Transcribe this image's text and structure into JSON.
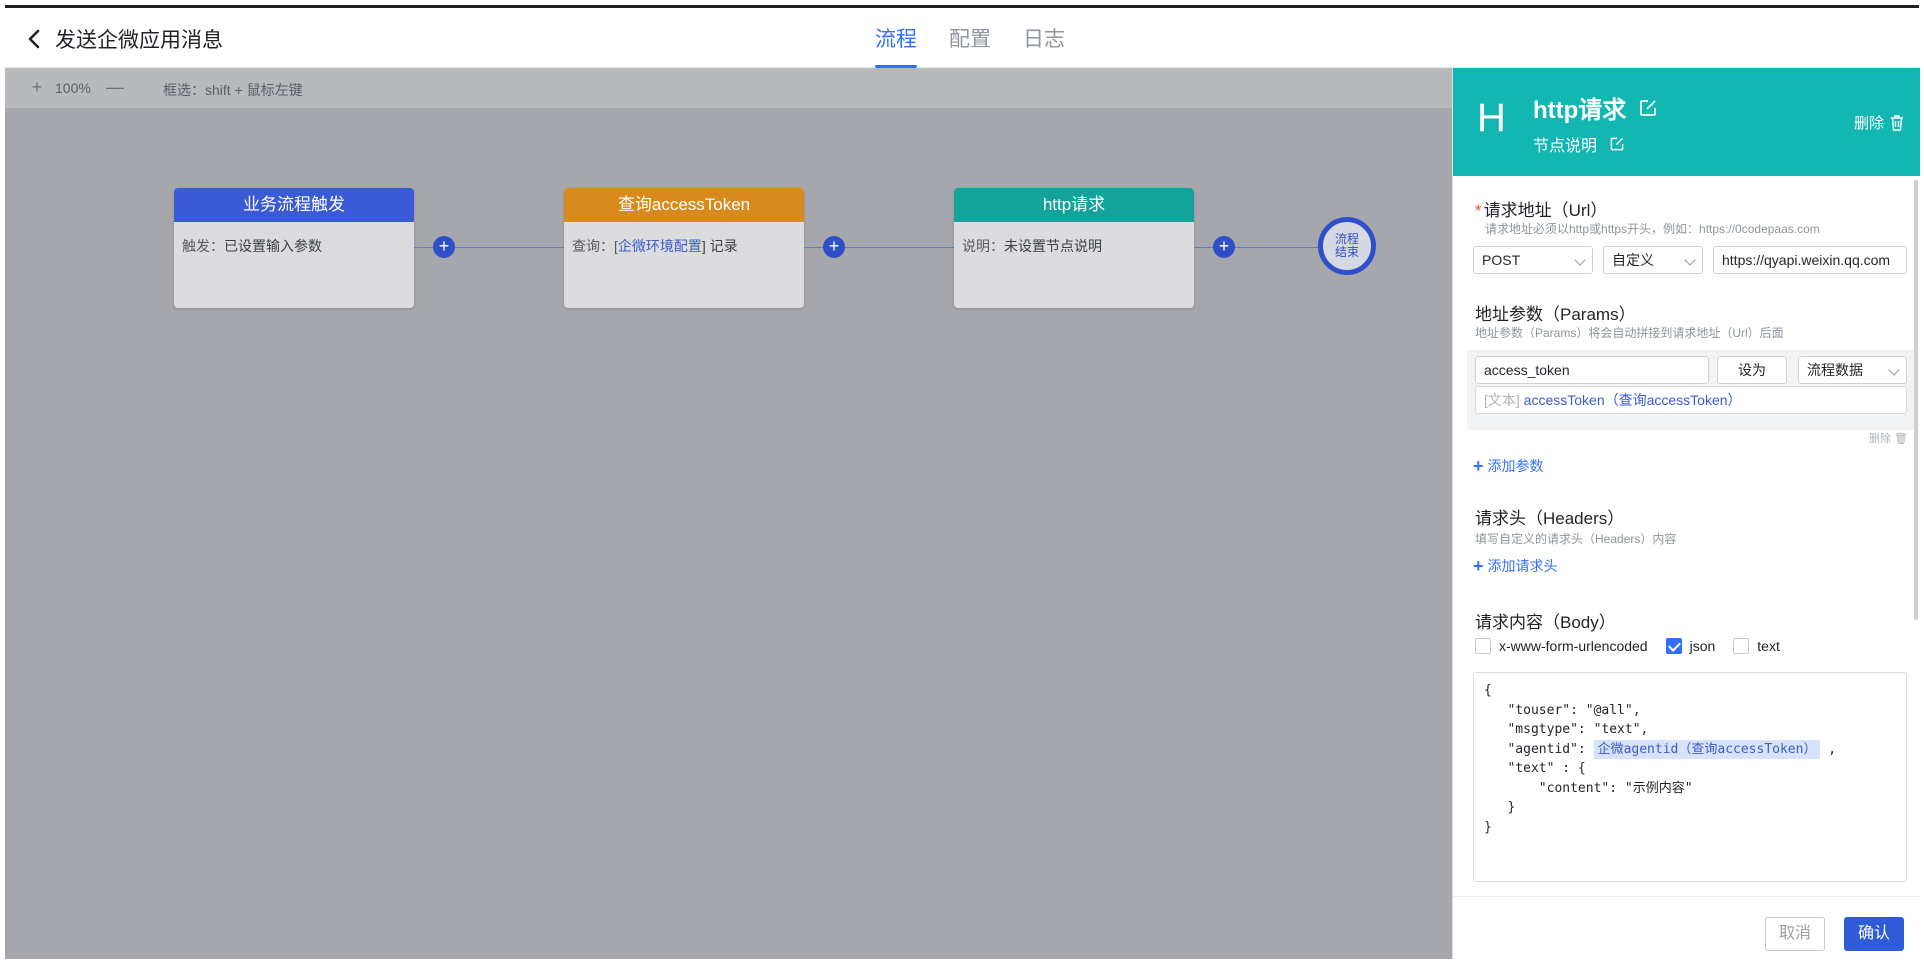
{
  "header": {
    "title": "发送企微应用消息",
    "tabs": [
      {
        "label": "流程",
        "active": true
      },
      {
        "label": "配置",
        "active": false
      },
      {
        "label": "日志",
        "active": false
      }
    ]
  },
  "canvas": {
    "zoom": "100%",
    "hint": "框选：shift + 鼠标左键",
    "nodes": [
      {
        "title": "业务流程触发",
        "color": "#3b5bd6",
        "label": "触发：",
        "value": "已设置输入参数"
      },
      {
        "title": "查询accessToken",
        "color": "#d98a1c",
        "label": "查询：[",
        "link": "企微环境配置",
        "suffix": "] 记录"
      },
      {
        "title": "http请求",
        "color": "#14a39a",
        "label": "说明：",
        "value": "未设置节点说明"
      }
    ],
    "end_node": {
      "line1": "流程",
      "line2": "结束"
    }
  },
  "panel": {
    "letter": "H",
    "title": "http请求",
    "subtitle": "节点说明",
    "delete_label": "删除",
    "url_section": {
      "title": "请求地址（Url）",
      "desc": "请求地址必须以http或https开头，例如：https://0codepaas.com",
      "method": "POST",
      "mode": "自定义",
      "url": "https://qyapi.weixin.qq.com"
    },
    "params_section": {
      "title": "地址参数（Params）",
      "desc": "地址参数（Params）将会自动拼接到请求地址（Url）后面",
      "key": "access_token",
      "set_as": "设为",
      "source": "流程数据",
      "value_tag": "[文本]",
      "value_text": "accessToken（查询accessToken）",
      "row_delete": "删除",
      "add_label": "添加参数"
    },
    "headers_section": {
      "title": "请求头（Headers）",
      "desc": "填写自定义的请求头（Headers）内容",
      "add_label": "添加请求头"
    },
    "body_section": {
      "title": "请求内容（Body）",
      "options": [
        {
          "label": "x-www-form-urlencoded",
          "checked": false
        },
        {
          "label": "json",
          "checked": true
        },
        {
          "label": "text",
          "checked": false
        }
      ],
      "code_lines": [
        "{",
        "   \"touser\": \"@all\",",
        "   \"msgtype\": \"text\",",
        "   \"agentid\": ",
        "   \"text\" : {",
        "       \"content\": \"示例内容\"",
        "   }",
        "}"
      ],
      "agentid_token": "企微agentid（查询accessToken）",
      "agentid_suffix": " ,"
    },
    "footer": {
      "cancel": "取消",
      "confirm": "确认"
    }
  }
}
